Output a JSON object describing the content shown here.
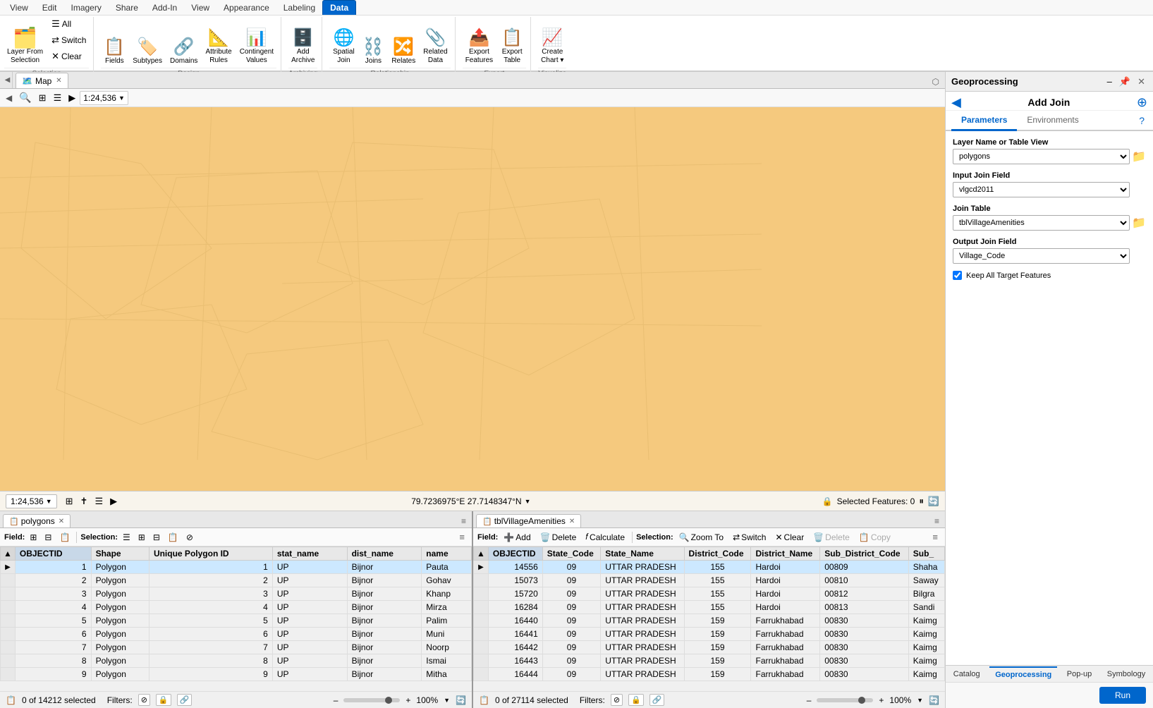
{
  "ribbon": {
    "tabs": [
      "View",
      "Edit",
      "Imagery",
      "Share",
      "Add-In",
      "View",
      "Appearance",
      "Labeling",
      "Data"
    ],
    "active_tab": "Data",
    "groups": {
      "selection": {
        "label": "Selection",
        "buttons": {
          "all": "All",
          "switch": "Switch",
          "layer_from": "Layer From\nSelection",
          "clear": "Clear"
        }
      },
      "design": {
        "label": "Design",
        "buttons": [
          "Fields",
          "Subtypes",
          "Domains",
          "Attribute Rules",
          "Contingent Values"
        ]
      },
      "archiving": {
        "label": "Archiving",
        "buttons": [
          "Add Archive"
        ]
      },
      "relationship": {
        "label": "Relationship",
        "buttons": [
          "Spatial Join",
          "Joins",
          "Relates",
          "Related Data"
        ]
      },
      "export": {
        "label": "Export",
        "buttons": [
          "Export Features",
          "Export Table"
        ]
      },
      "visualize": {
        "label": "Visualize",
        "buttons": [
          "Create Chart"
        ]
      }
    }
  },
  "map": {
    "tab_label": "Map",
    "scale": "1:24,536",
    "coords": "79.7236975°E 27.7148347°N",
    "selected_features": "Selected Features: 0"
  },
  "geoprocessing": {
    "title": "Geoprocessing",
    "tool_title": "Add Join",
    "tabs": [
      "Parameters",
      "Environments"
    ],
    "active_tab": "Parameters",
    "layer_name_label": "Layer Name or Table View",
    "layer_name_value": "polygons",
    "input_join_label": "Input Join Field",
    "input_join_value": "vlgcd2011",
    "join_table_label": "Join Table",
    "join_table_value": "tblVillageAmenities",
    "output_join_label": "Output Join Field",
    "output_join_value": "Village_Code",
    "keep_all_label": "Keep All Target Features",
    "keep_all_checked": true,
    "run_btn": "Run",
    "bottom_tabs": [
      "Catalog",
      "Geoprocessing",
      "Pop-up",
      "Symbology"
    ],
    "active_bottom_tab": "Geoprocessing"
  },
  "polygons_table": {
    "tab_label": "polygons",
    "field_label": "Field:",
    "selection_label": "Selection:",
    "status": "0 of 14212 selected",
    "filters_label": "Filters:",
    "zoom_label": "100%",
    "columns": [
      "OBJECTID",
      "Shape",
      "Unique Polygon ID",
      "stat_name",
      "dist_name",
      "name"
    ],
    "rows": [
      {
        "id": "1",
        "shape": "Polygon",
        "uid": "1",
        "stat": "UP",
        "dist": "Bijnor",
        "name": "Pauta"
      },
      {
        "id": "2",
        "shape": "Polygon",
        "uid": "2",
        "stat": "UP",
        "dist": "Bijnor",
        "name": "Gohav"
      },
      {
        "id": "3",
        "shape": "Polygon",
        "uid": "3",
        "stat": "UP",
        "dist": "Bijnor",
        "name": "Khanp"
      },
      {
        "id": "4",
        "shape": "Polygon",
        "uid": "4",
        "stat": "UP",
        "dist": "Bijnor",
        "name": "Mirza"
      },
      {
        "id": "5",
        "shape": "Polygon",
        "uid": "5",
        "stat": "UP",
        "dist": "Bijnor",
        "name": "Palim"
      },
      {
        "id": "6",
        "shape": "Polygon",
        "uid": "6",
        "stat": "UP",
        "dist": "Bijnor",
        "name": "Muni"
      },
      {
        "id": "7",
        "shape": "Polygon",
        "uid": "7",
        "stat": "UP",
        "dist": "Bijnor",
        "name": "Noorp"
      },
      {
        "id": "8",
        "shape": "Polygon",
        "uid": "8",
        "stat": "UP",
        "dist": "Bijnor",
        "name": "Ismai"
      },
      {
        "id": "9",
        "shape": "Polygon",
        "uid": "9",
        "stat": "UP",
        "dist": "Bijnor",
        "name": "Mitha"
      }
    ]
  },
  "amenities_table": {
    "tab_label": "tblVillageAmenities",
    "field_label": "Field:",
    "selection_label": "Selection:",
    "add_btn": "Add",
    "delete_btn": "Delete",
    "calculate_btn": "Calculate",
    "zoom_btn": "Zoom To",
    "switch_btn": "Switch",
    "clear_btn": "Clear",
    "delete2_btn": "Delete",
    "copy_btn": "Copy",
    "status": "0 of 27114 selected",
    "filters_label": "Filters:",
    "zoom_label": "100%",
    "columns": [
      "OBJECTID",
      "State_Code",
      "State_Name",
      "District_Code",
      "District_Name",
      "Sub_District_Code",
      "Sub_"
    ],
    "rows": [
      {
        "id": "14556",
        "sc": "09",
        "sn": "UTTAR PRADESH",
        "dc": "155",
        "dn": "Hardoi",
        "sdc": "00809",
        "sub": "Shaha"
      },
      {
        "id": "15073",
        "sc": "09",
        "sn": "UTTAR PRADESH",
        "dc": "155",
        "dn": "Hardoi",
        "sdc": "00810",
        "sub": "Saway"
      },
      {
        "id": "15720",
        "sc": "09",
        "sn": "UTTAR PRADESH",
        "dc": "155",
        "dn": "Hardoi",
        "sdc": "00812",
        "sub": "Bilgra"
      },
      {
        "id": "16284",
        "sc": "09",
        "sn": "UTTAR PRADESH",
        "dc": "155",
        "dn": "Hardoi",
        "sdc": "00813",
        "sub": "Sandi"
      },
      {
        "id": "16440",
        "sc": "09",
        "sn": "UTTAR PRADESH",
        "dc": "159",
        "dn": "Farrukhabad",
        "sdc": "00830",
        "sub": "Kaimg"
      },
      {
        "id": "16441",
        "sc": "09",
        "sn": "UTTAR PRADESH",
        "dc": "159",
        "dn": "Farrukhabad",
        "sdc": "00830",
        "sub": "Kaimg"
      },
      {
        "id": "16442",
        "sc": "09",
        "sn": "UTTAR PRADESH",
        "dc": "159",
        "dn": "Farrukhabad",
        "sdc": "00830",
        "sub": "Kaimg"
      },
      {
        "id": "16443",
        "sc": "09",
        "sn": "UTTAR PRADESH",
        "dc": "159",
        "dn": "Farrukhabad",
        "sdc": "00830",
        "sub": "Kaimg"
      },
      {
        "id": "16444",
        "sc": "09",
        "sn": "UTTAR PRADESH",
        "dc": "159",
        "dn": "Farrukhabad",
        "sdc": "00830",
        "sub": "Kaimg"
      }
    ]
  }
}
